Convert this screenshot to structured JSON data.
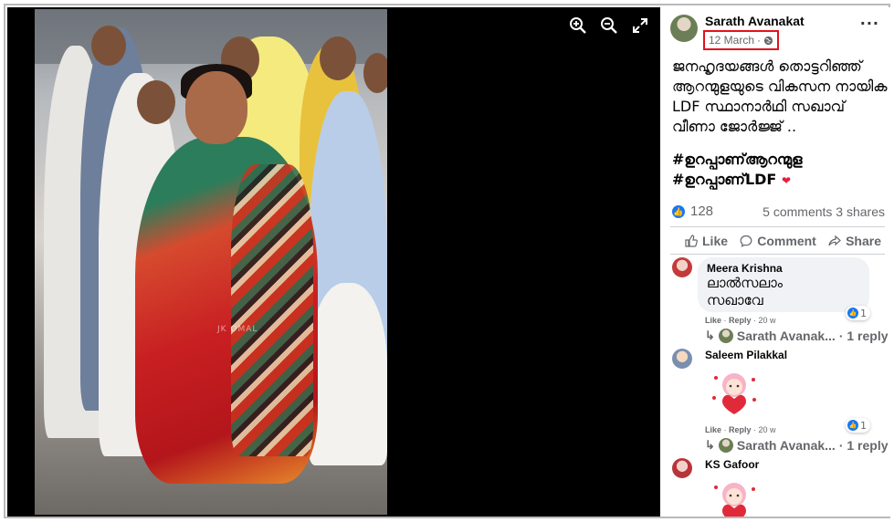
{
  "viewer": {
    "watermark": "JK OMAL",
    "tools": [
      "zoom-in-icon",
      "zoom-out-icon",
      "fullscreen-icon"
    ]
  },
  "post": {
    "author": "Sarath Avanakat",
    "date": "12 March",
    "privacy_icon": "globe-icon",
    "more_label": "···",
    "text": "ജനഹൃദയങ്ങൾ തൊട്ടറിഞ്ഞ് ആറന്മുളയുടെ വികസന നായിക LDF സ്ഥാനാർഥി സഖാവ് വീണാ ജോർജ്ജ് ..",
    "hashtag1": "#ഉറപ്പാണ്ആറന്മുള",
    "hashtag2": "#ഉറപ്പാണ്LDF",
    "hashtag2_emoji": "❤",
    "reactions": {
      "count": "128",
      "comments": "5 comments",
      "shares": "3 shares"
    },
    "actions": {
      "like": "Like",
      "comment": "Comment",
      "share": "Share"
    }
  },
  "comments": [
    {
      "name": "Meera Krishna",
      "text_line1": "ലാൽസലാം",
      "text_line2": "സഖാവേ",
      "like_label": "Like",
      "reply_label": "Reply",
      "age": "20 w",
      "reaction_count": "1",
      "reply_author": "Sarath Avanak...",
      "reply_count": "· 1 reply"
    },
    {
      "name": "Saleem Pilakkal",
      "like_label": "Like",
      "reply_label": "Reply",
      "age": "20 w",
      "reaction_count": "1",
      "reply_author": "Sarath Avanak...",
      "reply_count": "· 1 reply"
    },
    {
      "name": "KS Gafoor"
    }
  ],
  "colors": {
    "highlight_box": "#e0131b",
    "fb_blue": "#1877f2",
    "heart": "#e41e3f"
  }
}
